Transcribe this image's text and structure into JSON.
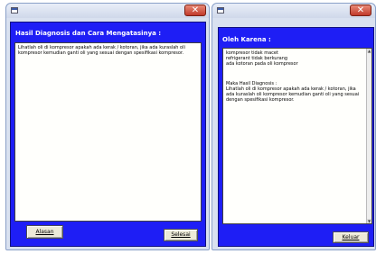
{
  "left_dialog": {
    "heading": "Hasil Diagnosis dan Cara Mengatasinya :",
    "body": "Lihatlah oli di kompresor apakah ada kerak / kotoran, jika ada kuraslah oli kompresor kemudian ganti oli yang sesuai dengan spesifikasi kompresor.",
    "back_button": "Alasan",
    "finish_button": "Selesai",
    "close_glyph": "✕"
  },
  "right_dialog": {
    "heading": "Oleh Karena :",
    "causes": "kompresor tidak macet\nrefrigerant tidak berkurang\nada kotoran pada oli kompresor",
    "result_label": "Maka Hasil Diagnosis :",
    "result_text": "Lihatlah oli di kompresor apakah ada kerak / kotoran, jika ada kuraslah oli kompresor kemudian ganti oli yang sesuai dengan spesifikasi kompresor.",
    "exit_button": "Keluar",
    "close_glyph": "✕"
  }
}
